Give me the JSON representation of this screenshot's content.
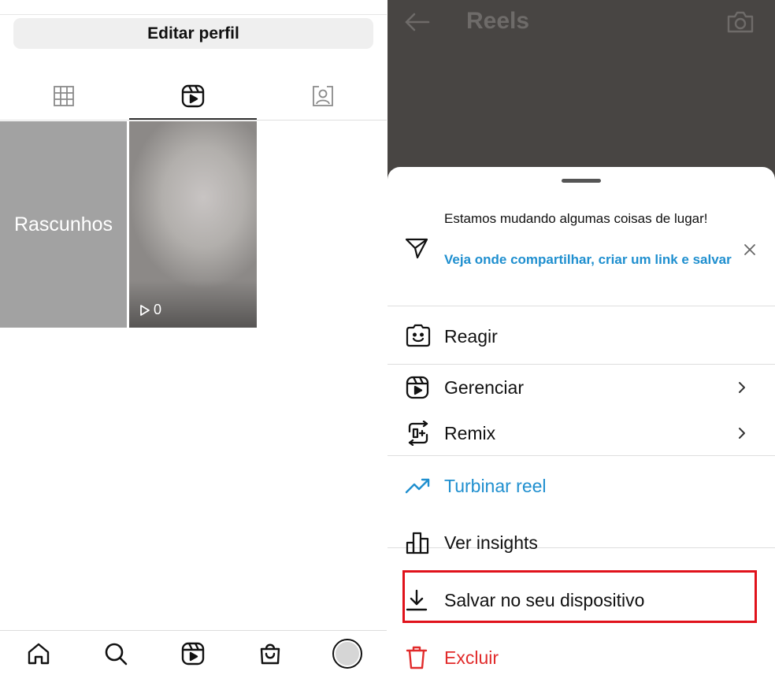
{
  "profile": {
    "edit_button": "Editar perfil",
    "drafts_label": "Rascunhos",
    "reel_views": "0"
  },
  "reels_header": {
    "title": "Reels"
  },
  "sheet": {
    "notice_text": "Estamos mudando algumas coisas de lugar!",
    "notice_link": "Veja onde compartilhar, criar um link e salvar",
    "items": [
      {
        "label": "Reagir",
        "icon": "react-face-icon"
      },
      {
        "label": "Gerenciar",
        "icon": "reels-icon"
      },
      {
        "label": "Remix",
        "icon": "remix-icon"
      },
      {
        "label": "Turbinar reel",
        "icon": "trending-up-icon"
      },
      {
        "label": "Ver insights",
        "icon": "bar-chart-icon"
      },
      {
        "label": "Salvar no seu dispositivo",
        "icon": "download-icon"
      },
      {
        "label": "Excluir",
        "icon": "trash-icon"
      }
    ]
  },
  "colors": {
    "link_blue": "#1f8fcf",
    "danger_red": "#e12b2b",
    "highlight_red": "#e0121b",
    "reels_background": "#484543"
  }
}
